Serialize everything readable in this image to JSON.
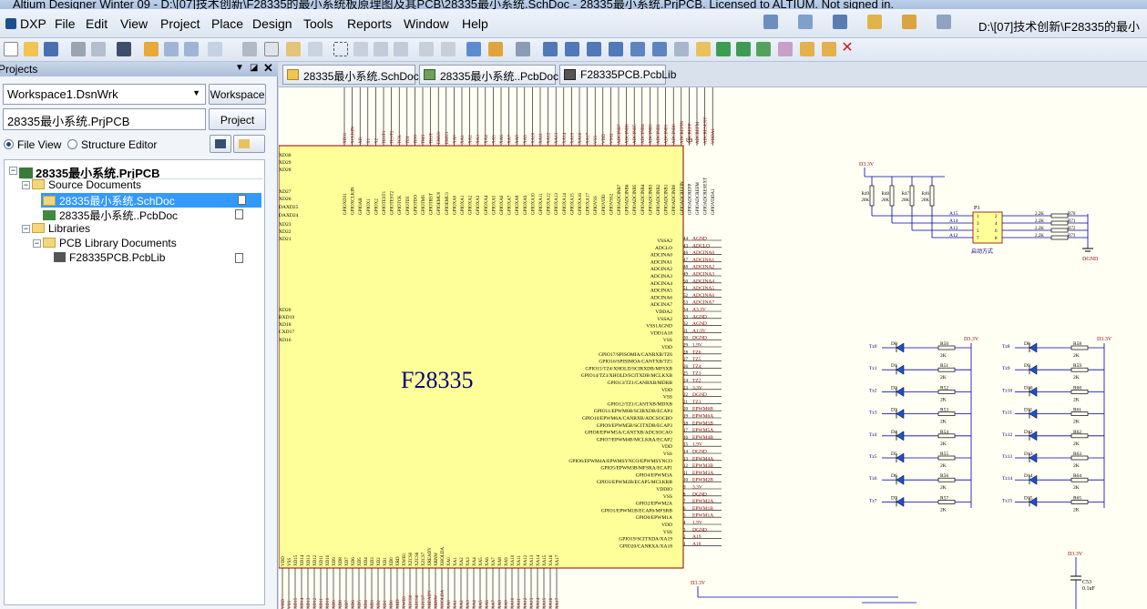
{
  "window": {
    "title": "Altium Designer Winter 09 - D:\\[07]技术创新\\F28335的最小系统板原理图及其PCB\\28335最小系统.SchDoc - 28335最小系统.PrjPCB. Licensed to ALTIUM. Not signed in."
  },
  "menu": {
    "items": [
      "DXP",
      "File",
      "Edit",
      "View",
      "Project",
      "Place",
      "Design",
      "Tools",
      "Reports",
      "Window",
      "Help"
    ],
    "path": "D:\\[07]技术创新\\F28335的最小"
  },
  "panel": {
    "title": "Projects",
    "workspace_value": "Workspace1.DsnWrk",
    "workspace_button": "Workspace",
    "project_value": "28335最小系统.PrjPCB",
    "project_button": "Project",
    "file_view": "File View",
    "structure_editor": "Structure Editor",
    "tree": {
      "project": "28335最小系统.PrjPCB",
      "source_docs": "Source Documents",
      "schdoc": "28335最小系统.SchDoc",
      "pcbdoc": "28335最小系统..PcbDoc",
      "libraries": "Libraries",
      "pcb_lib_docs": "PCB Library Documents",
      "pcblib": "F28335PCB.PcbLib"
    }
  },
  "tabs": [
    "28335最小系统.SchDoc",
    "28335最小系统..PcbDoc",
    "F28335PCB.PcbLib"
  ],
  "schematic": {
    "chip_name": "F28335",
    "designator": "U3",
    "right_pins": [
      {
        "num": "44",
        "name": "VSSA2",
        "net": "AGND"
      },
      {
        "num": "43",
        "name": "ADCLO",
        "net": "ADCLO"
      },
      {
        "num": "46",
        "name": "ADCINA0",
        "net": "ADCINA0"
      },
      {
        "num": "47",
        "name": "ADCINA1",
        "net": "ADCINA1"
      },
      {
        "num": "48",
        "name": "ADCINA2",
        "net": "ADCINA2"
      },
      {
        "num": "49",
        "name": "ADCINA3",
        "net": "ADCINA3"
      },
      {
        "num": "50",
        "name": "ADCINA4",
        "net": "ADCINA4"
      },
      {
        "num": "51",
        "name": "ADCINA5",
        "net": "ADCINA5"
      },
      {
        "num": "52",
        "name": "ADCINA6",
        "net": "ADCINA6"
      },
      {
        "num": "53",
        "name": "ADCINA7",
        "net": "ADCINA7"
      },
      {
        "num": "34",
        "name": "VDDA2",
        "net": "A3.3V"
      },
      {
        "num": "33",
        "name": "VSSA2",
        "net": "AGND"
      },
      {
        "num": "32",
        "name": "VSS1AGND",
        "net": "AGND"
      },
      {
        "num": "31",
        "name": "VDD1A18",
        "net": "A1.9V"
      },
      {
        "num": "30",
        "name": "VSS",
        "net": "DGND"
      },
      {
        "num": "29",
        "name": "VDD",
        "net": "1.9V"
      },
      {
        "num": "28",
        "name": "GPIO17/SPISOMIA/CANRXB/TZ6",
        "net": "TZ6"
      },
      {
        "num": "27",
        "name": "GPIO16/SPISIMOA/CANTXB/TZ5",
        "net": "TZ5"
      },
      {
        "num": "26",
        "name": "GPIO15/TZ4/XHOLD/SCIRXDB/MFSXB",
        "net": "TZ4"
      },
      {
        "num": "25",
        "name": "GPIO14/TZ3/XHOLD/SCITXDB/MCLKXB",
        "net": "TZ3"
      },
      {
        "num": "24",
        "name": "GPIO13/TZ1/CANRXB/MDRB",
        "net": "TZ2"
      },
      {
        "num": "23",
        "name": "VDD",
        "net": "3.3V"
      },
      {
        "num": "22",
        "name": "VSS",
        "net": "DGND"
      },
      {
        "num": "21",
        "name": "GPIO12/TZ1/CANTXB/MDXB",
        "net": "TZ1"
      },
      {
        "num": "20",
        "name": "GPIO11/EPWM6B/SCIRXDB/ECAP4",
        "net": "EPWM6B"
      },
      {
        "num": "19",
        "name": "GPIO10/EPWM6A/CANRXB/ADCSOCBO",
        "net": "EPWM6A"
      },
      {
        "num": "18",
        "name": "GPIO9/EPWM5B/SCITXDB/ECAP3",
        "net": "EPWM5B"
      },
      {
        "num": "17",
        "name": "GPIO8/EPWM5A/CANTXB/ADCSOCAO",
        "net": "EPWM5A"
      },
      {
        "num": "16",
        "name": "GPIO7/EPWM4B/MCLKRA/ECAP2",
        "net": "EPWM4B"
      },
      {
        "num": "15",
        "name": "VDD",
        "net": "1.9V"
      },
      {
        "num": "14",
        "name": "VSS",
        "net": "DGND"
      },
      {
        "num": "13",
        "name": "GPIO6/EPWM4A/EPWMSYNCO/EPWMSYNCO",
        "net": "EPWM4A"
      },
      {
        "num": "12",
        "name": "GPIO5/EPWM3B/MFSRA/ECAP1",
        "net": "EPWM3B"
      },
      {
        "num": "11",
        "name": "GPIO4/EPWM3A",
        "net": "EPWM3A"
      },
      {
        "num": "10",
        "name": "GPIO3/EPWM2B/ECAP5/MCLKRB",
        "net": "EPWM2B"
      },
      {
        "num": "9",
        "name": "VDDIO",
        "net": "3.3V"
      },
      {
        "num": "8",
        "name": "VSS",
        "net": "DGND"
      },
      {
        "num": "7",
        "name": "GPIO2/EPWM2A",
        "net": "EPWM2A"
      },
      {
        "num": "6",
        "name": "GPIO1/EPWM1B/ECAP6/MFSRB",
        "net": "EPWM1B"
      },
      {
        "num": "5",
        "name": "GPIO0/EPWM1A",
        "net": "EPWM1A"
      },
      {
        "num": "4",
        "name": "VDD",
        "net": "1.9V"
      },
      {
        "num": "3",
        "name": "VSS",
        "net": "DGND"
      },
      {
        "num": "2",
        "name": "GPIO19/SCITXDA/XA19",
        "net": "A19"
      },
      {
        "num": "1",
        "name": "GPIO20/CANRXA/XA18",
        "net": "A18"
      }
    ],
    "left_pins": [
      "XD30",
      "XD29",
      "XD28",
      "XD27",
      "XD26",
      "XD25",
      "XD24",
      "XD23",
      "XD22",
      "XD21",
      "XD20",
      "XD19",
      "XD18",
      "XD17",
      "XD16"
    ],
    "left_pin_prefixes": [
      "",
      "",
      "",
      "",
      "",
      "DA",
      "DA",
      "",
      "",
      "",
      "",
      "B",
      "",
      "C",
      ""
    ],
    "top_pins": [
      "XD31",
      "XCLKIN",
      "AB",
      "X1",
      "X2",
      "TEST1",
      "TEST2",
      "TCK",
      "TDI",
      "TDO",
      "TMS",
      "TRST",
      "EMU0",
      "EMU1",
      "XA0",
      "XA1",
      "XA2",
      "XA3",
      "XA4",
      "XA5",
      "XA6",
      "XA7",
      "XA8",
      "XA9",
      "XA10",
      "XA11",
      "XA12",
      "XA13",
      "XA14",
      "XA15",
      "XA16",
      "XA17",
      "VSS",
      "VDD",
      "VSS2",
      "ADCINB7",
      "ADCINB6",
      "ADCINB5",
      "ADCINB4",
      "ADCINB3",
      "ADCINB2",
      "ADCINB1",
      "ADCINB0",
      "ADCREFIN",
      "ADCREFP",
      "ADCREFM",
      "ADCRESEXT",
      "VDDA1"
    ],
    "bottom_pins": [
      "VDD",
      "VSS",
      "XD15",
      "XD14",
      "XD13",
      "XD12",
      "XD11",
      "XD10",
      "XD9",
      "XD8",
      "XD7",
      "XD6",
      "XD5",
      "XD4",
      "XD3",
      "XD2",
      "XD1",
      "XD0",
      "XRD",
      "XWE0",
      "XZCS0",
      "XZCS6",
      "XZCS7",
      "XREADY",
      "XRNW",
      "XHOLDA",
      "XA0",
      "XA1",
      "XA2",
      "XA3",
      "XA4",
      "XA5",
      "XA6",
      "XA7",
      "XA8",
      "XA9",
      "XA10",
      "XA11",
      "XA12",
      "XA13",
      "XA14",
      "XA15",
      "XA16",
      "XA17"
    ],
    "resistor_net": {
      "power": "D3.3V",
      "resistors": [
        "R49",
        "R48",
        "R47",
        "R46"
      ],
      "value": "20K",
      "header": "P3",
      "pins": [
        "A15",
        "A14",
        "A13",
        "A12"
      ],
      "series": [
        "R70",
        "R71",
        "R72",
        "R73"
      ],
      "series_value": "2.2K",
      "caption": "启动方式",
      "gnd": "DGND"
    },
    "leds_left": {
      "power": "D3.3V",
      "nets": [
        "Tz0",
        "Tz1",
        "Tz2",
        "Tz3",
        "Tz4",
        "Tz5",
        "Tz6",
        "Tz7"
      ],
      "leds": [
        "D0",
        "D1",
        "D2",
        "D3",
        "D4",
        "D5",
        "D6",
        "D7"
      ],
      "resistors": [
        "R50",
        "R51",
        "R52",
        "R53",
        "R54",
        "R55",
        "R56",
        "R57"
      ],
      "value": "2K"
    },
    "leds_right": {
      "power": "D3.3V",
      "nets": [
        "Tz8",
        "Tz9",
        "Tz10",
        "Tz11",
        "Tz12",
        "Tz13",
        "Tz14",
        "Tz15"
      ],
      "leds": [
        "D8",
        "D9",
        "D10",
        "D11",
        "D12",
        "D13",
        "D14",
        "D15"
      ],
      "resistors": [
        "R58",
        "R59",
        "R60",
        "R61",
        "R62",
        "R63",
        "R64",
        "R65"
      ],
      "value": "2K"
    },
    "cap": {
      "power": "D3.3V",
      "name": "C53",
      "value": "0.1uF"
    },
    "bottom_power": "D3.3V"
  },
  "colors": {
    "sheet": "#fffff4",
    "chip_fill": "#ffff99",
    "pin_blue": "#000088",
    "net_red": "#8b0000",
    "wire": "#0000b0"
  }
}
